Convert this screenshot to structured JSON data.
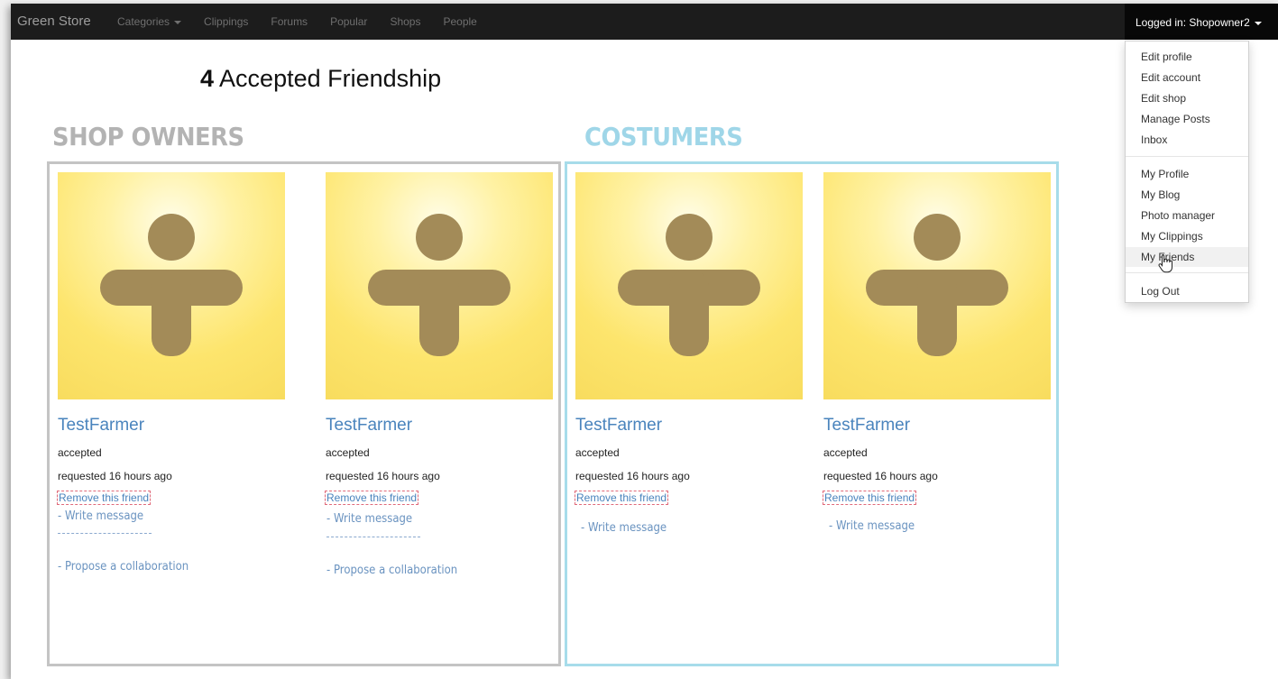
{
  "navbar": {
    "brand": "Green Store",
    "items": [
      {
        "label": "Categories",
        "has_caret": true
      },
      {
        "label": "Clippings"
      },
      {
        "label": "Forums"
      },
      {
        "label": "Popular"
      },
      {
        "label": "Shops"
      },
      {
        "label": "People"
      }
    ],
    "user_toggle": "Logged in: Shopowner2"
  },
  "page": {
    "count": "4",
    "title": "Accepted Friendship"
  },
  "sections": {
    "owners_title": "SHOP OWNERS",
    "customers_title": "COSTUMERS"
  },
  "cards": [
    {
      "name": "TestFarmer",
      "status": "accepted",
      "requested": "requested 16 hours ago",
      "remove": "Remove this friend",
      "write": "- Write message",
      "propose": "- Propose a collaboration"
    },
    {
      "name": "TestFarmer",
      "status": "accepted",
      "requested": "requested 16 hours ago",
      "remove": "Remove this friend",
      "write": "- Write message",
      "propose": "- Propose a collaboration"
    },
    {
      "name": "TestFarmer",
      "status": "accepted",
      "requested": "requested 16 hours ago",
      "remove": "Remove this friend",
      "write": "- Write message"
    },
    {
      "name": "TestFarmer",
      "status": "accepted",
      "requested": "requested 16 hours ago",
      "remove": "Remove this friend",
      "write": "- Write message"
    }
  ],
  "dropdown": {
    "group1": [
      "Edit profile",
      "Edit account",
      "Edit shop",
      "Manage Posts",
      "Inbox"
    ],
    "group2": [
      "My Profile",
      "My Blog",
      "Photo manager",
      "My Clippings",
      "My Friends"
    ],
    "group3": [
      "Log Out"
    ],
    "hovered": "My Friends"
  },
  "colors": {
    "navbar_bg": "#1c1c1c",
    "link_blue": "#4a84bd",
    "owners_border": "#c4c4c4",
    "customers_border": "#a7dcea",
    "customers_title": "#9fd6e8"
  }
}
